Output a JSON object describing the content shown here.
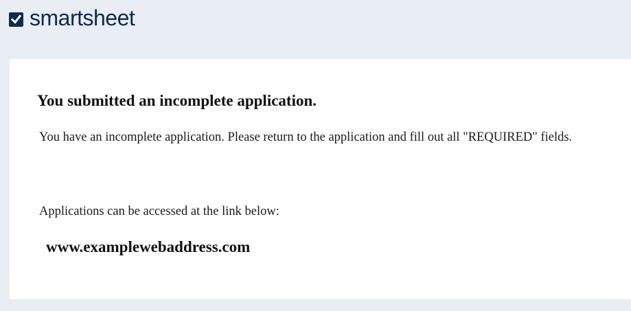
{
  "brand": {
    "name": "smartsheet",
    "color": "#0f2a4f",
    "icon": "check-box-icon"
  },
  "message": {
    "title": "You submitted an incomplete application.",
    "body": "You have an incomplete application. Please return to the application and fill out all \"REQUIRED\" fields.",
    "access_text": "Applications can be accessed at the link below:",
    "link_text": "www.examplewebaddress.com"
  },
  "colors": {
    "header_background": "#e9eef5",
    "card_background": "#ffffff",
    "text": "#111111"
  }
}
